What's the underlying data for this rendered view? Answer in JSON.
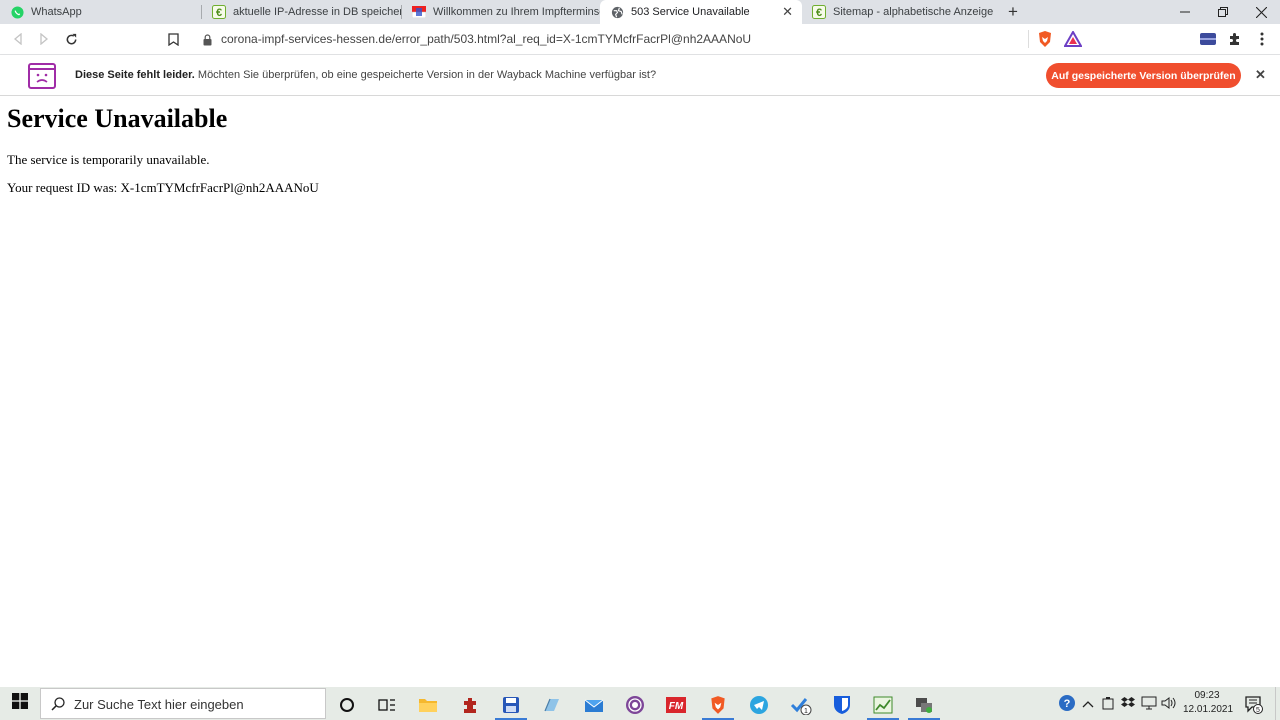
{
  "browser": {
    "tabs": [
      {
        "title": "WhatsApp",
        "active": false
      },
      {
        "title": "aktuelle IP-Adresse in DB speichern",
        "active": false
      },
      {
        "title": "Willkommen zu Ihrem Impfterminserv",
        "active": false
      },
      {
        "title": "503 Service Unavailable",
        "active": true
      },
      {
        "title": "Sitemap - alphabetische Anzeige",
        "active": false
      }
    ],
    "address": "corona-impf-services-hessen.de/error_path/503.html?al_req_id=X-1cmTYMcfrFacrPl@nh2AAANoU"
  },
  "infobar": {
    "bold": "Diese Seite fehlt leider.",
    "message": "Möchten Sie überprüfen, ob eine gespeicherte Version in der Wayback Machine verfügbar ist?",
    "button": "Auf gespeicherte Version überprüfen",
    "accent": "#f04e2e"
  },
  "page": {
    "heading": "Service Unavailable",
    "line1": "The service is temporarily unavailable.",
    "line2": "Your request ID was: X-1cmTYMcfrFacrPl@nh2AAANoU"
  },
  "taskbar": {
    "search_placeholder": "Zur Suche Text hier eingeben",
    "time": "09:23",
    "date": "12.01.2021",
    "notification_count": "5",
    "task_badge": "1"
  }
}
